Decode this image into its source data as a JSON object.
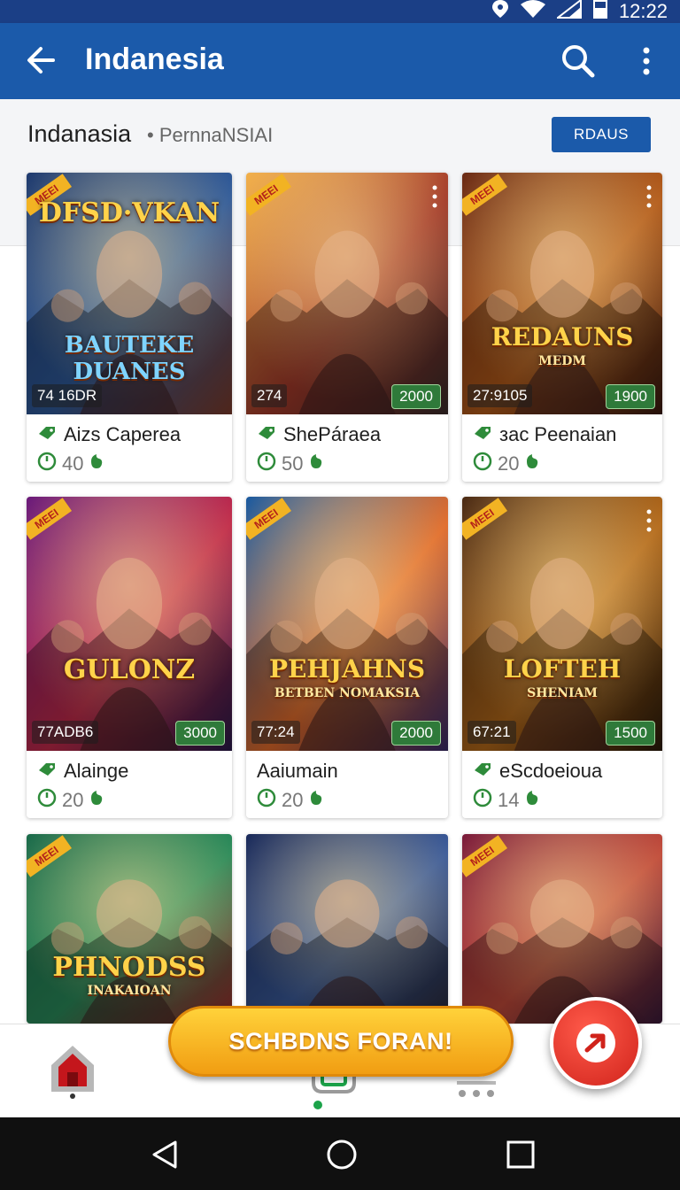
{
  "status_bar": {
    "time": "12:22",
    "icons": [
      "location-icon",
      "wifi-icon",
      "signal-icon",
      "battery-icon"
    ]
  },
  "app_bar": {
    "title": "Indanesia",
    "icons": [
      "back-arrow-icon",
      "search-icon",
      "more-vert-icon"
    ]
  },
  "sub_header": {
    "crumb": "Indanasia",
    "crumb_sub": "• PernnaNSIAI",
    "filter_button": "RDAUS"
  },
  "cards": [
    {
      "art_title": "DFSD·VKAN",
      "art_subtitle": "BAUTEKE DUANES",
      "badge": "MEEI",
      "stat_left": "74 16DR",
      "stat_right": "",
      "label": "Aizs Caperea",
      "meta": "40",
      "colors": [
        "#1e3a6e",
        "#2f5a9a",
        "#7a3a2a"
      ]
    },
    {
      "art_title": "",
      "art_subtitle": "",
      "badge": "MEEI",
      "stat_left": "274",
      "stat_right": "2000",
      "label": "ShePáraea",
      "meta": "50",
      "colors": [
        "#f2b04a",
        "#a33a2a",
        "#3a2a2a"
      ]
    },
    {
      "art_title": "REDAUNS",
      "art_subtitle": "MEDM",
      "badge": "MEEI",
      "stat_left": "27:9105",
      "stat_right": "1900",
      "label": "зас Peenaian",
      "meta": "20",
      "colors": [
        "#6a2a14",
        "#b25a1a",
        "#3a1a10"
      ]
    },
    {
      "art_title": "GULONZ",
      "art_subtitle": "",
      "badge": "MEEI",
      "stat_left": "77ADB6",
      "stat_right": "3000",
      "label": "Alainge",
      "meta": "20",
      "colors": [
        "#6a1a7a",
        "#c02a4a",
        "#2a1a4a"
      ]
    },
    {
      "art_title": "PEHJAHNS",
      "art_subtitle": "BETBEN NOMAKSIA",
      "badge": "MEEI",
      "stat_left": "77:24",
      "stat_right": "2000",
      "label": "Aaiumain",
      "meta": "20",
      "colors": [
        "#1a5aa0",
        "#e06a2a",
        "#3a2a6a"
      ]
    },
    {
      "art_title": "LOFTEH",
      "art_subtitle": "SHENIAM",
      "badge": "MEEI",
      "stat_left": "67:21",
      "stat_right": "1500",
      "label": "eScdoeioua",
      "meta": "14",
      "colors": [
        "#4a2a14",
        "#b2681a",
        "#2a1a0a"
      ]
    },
    {
      "art_title": "PHNODSS",
      "art_subtitle": "INAKAIOAN",
      "badge": "MEEI",
      "stat_left": "",
      "stat_right": "",
      "label": "",
      "meta": "",
      "colors": [
        "#1a6a4a",
        "#2a8a5a",
        "#a02a2a"
      ]
    },
    {
      "art_title": "",
      "art_subtitle": "",
      "badge": "",
      "stat_left": "",
      "stat_right": "",
      "label": "",
      "meta": "",
      "colors": [
        "#1a2a5a",
        "#3a5a9a",
        "#2a2a3a"
      ]
    },
    {
      "art_title": "",
      "art_subtitle": "",
      "badge": "MEEI",
      "stat_left": "",
      "stat_right": "",
      "label": "",
      "meta": "",
      "colors": [
        "#7a1a3a",
        "#c04a3a",
        "#3a1a3a"
      ]
    }
  ],
  "cta": {
    "label": "SCHBDNS FORAN!"
  },
  "bottom_nav": {
    "items": [
      "home-icon",
      "center-tab-icon",
      "list-icon"
    ],
    "active_color": "#1ca34a"
  },
  "system_nav": {
    "items": [
      "back-icon",
      "home-circle-icon",
      "recents-icon"
    ]
  },
  "colors": {
    "app_bar": "#1b5aaa",
    "status_bar": "#1b3f86",
    "accent_green": "#2f7a3a",
    "cta": "#f7b12a",
    "fab": "#d0231b"
  }
}
